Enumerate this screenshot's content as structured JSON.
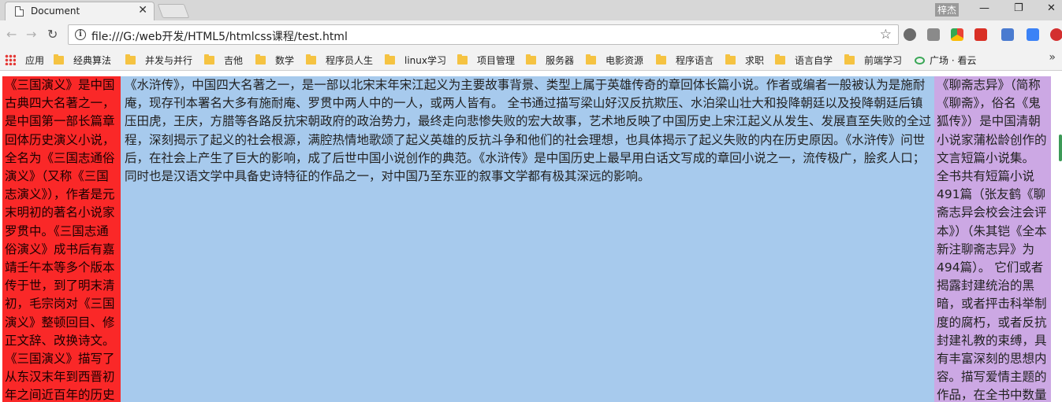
{
  "window": {
    "tab_title": "Document",
    "tab_close": "✕",
    "user_label": "梓杰",
    "controls": {
      "minimize": "—",
      "maximize": "❐",
      "close": "✕"
    }
  },
  "toolbar": {
    "back": "←",
    "forward": "→",
    "reload": "↻",
    "url": "file:///G:/web开发/HTML5/htmlcss课程/test.html",
    "star": "☆",
    "extension_icons": [
      "gear-icon",
      "reader-icon",
      "chrome-app-icon",
      "fe-icon",
      "translate-off-icon",
      "download-icon",
      "stop-icon"
    ]
  },
  "bookmarks": {
    "apps_label": "应用",
    "items": [
      "经典算法",
      "并发与并行",
      "吉他",
      "数学",
      "程序员人生",
      "linux学习",
      "项目管理",
      "服务器",
      "电影资源",
      "程序语言",
      "求职",
      "语言自学",
      "前端学习",
      "广场 · 看云"
    ],
    "more": "»"
  },
  "content": {
    "left_text": "《三国演义》是中国古典四大名著之一，是中国第一部长篇章回体历史演义小说，全名为《三国志通俗演义》（又称《三国志演义》），作者是元末明初的著名小说家罗贯中。《三国志通俗演义》成书后有嘉靖壬午本等多个版本传于世，到了明末清初，毛宗岗对《三国演义》整顿回目、修正文辞、改换诗文。《三国演义》描写了从东汉末年到西晋初年之间近百年的历史风云，以描写战争为主，诉说了东汉",
    "middle_text": "《水浒传》，中国四大名著之一，是一部以北宋末年宋江起义为主要故事背景、类型上属于英雄传奇的章回体长篇小说。作者或编者一般被认为是施耐庵，现存刊本署名大多有施耐庵、罗贯中两人中的一人，或两人皆有。 全书通过描写梁山好汉反抗欺压、水泊梁山壮大和投降朝廷以及投降朝廷后镇压田虎，王庆，方腊等各路反抗宋朝政府的政治势力，最终走向悲惨失败的宏大故事，艺术地反映了中国历史上宋江起义从发生、发展直至失败的全过程，深刻揭示了起义的社会根源，满腔热情地歌颂了起义英雄的反抗斗争和他们的社会理想，也具体揭示了起义失败的内在历史原因。《水浒传》问世后，在社会上产生了巨大的影响，成了后世中国小说创作的典范。《水浒传》是中国历史上最早用白话文写成的章回小说之一，流传极广，脍炙人口；同时也是汉语文学中具备史诗特征的作品之一，对中国乃至东亚的叙事文学都有极其深远的影响。",
    "right_text": "《聊斋志异》（简称《聊斋》，俗名《鬼狐传》）是中国清朝小说家蒲松龄创作的文言短篇小说集。 全书共有短篇小说491篇（张友鹤《聊斋志异会校会注会评本》）（朱其铠《全本新注聊斋志异》为494篇）。 它们或者揭露封建统治的黑暗，或者抨击科举制度的腐朽，或者反抗封建礼教的束缚，具有丰富深刻的思想内容。描写爱情主题的作品，在全书中数量最多，它们表现了强烈的反封建礼教的精神"
  },
  "colors": {
    "left_bg": "#fa2828",
    "middle_bg": "#a7caed",
    "right_bg": "#cca8e4"
  }
}
